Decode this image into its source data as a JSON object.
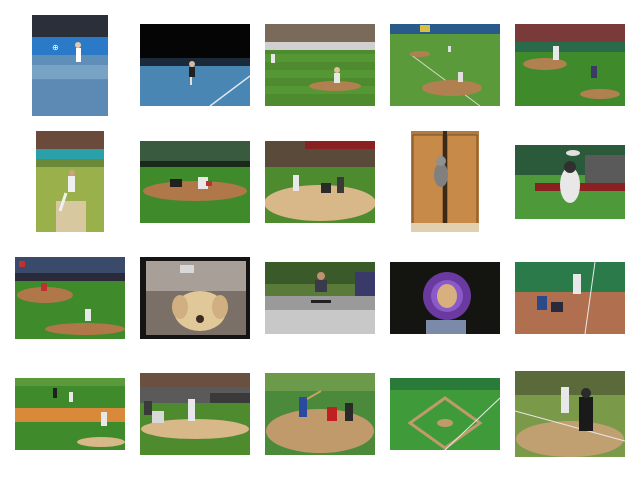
{
  "gallery": {
    "items": [
      {
        "subject": "tennis-player-serving",
        "colors": {
          "bg": "#2a6aa8",
          "ground": "#5f8fb8"
        }
      },
      {
        "subject": "tennis-player-night-court",
        "colors": {
          "bg": "#0b0b0b",
          "ground": "#4a86b4"
        }
      },
      {
        "subject": "baseball-pitcher-infield",
        "colors": {
          "bg": "#6a8a4a",
          "ground": "#4e8a2e"
        }
      },
      {
        "subject": "baseball-pitch-wide-field",
        "colors": {
          "bg": "#3a7a30",
          "ground": "#5a9a3a"
        }
      },
      {
        "subject": "baseball-pitcher-mound",
        "colors": {
          "bg": "#2f6b3a",
          "ground": "#3f8a2a"
        }
      },
      {
        "subject": "cricket-bowler",
        "colors": {
          "bg": "#6e8a3a",
          "ground": "#9ab04a"
        }
      },
      {
        "subject": "baseball-slide-home",
        "colors": {
          "bg": "#3a5a30",
          "ground": "#3f8a2a"
        }
      },
      {
        "subject": "baseball-batter-catcher-umpire",
        "colors": {
          "bg": "#5a4a3a",
          "ground": "#4e8a2e"
        }
      },
      {
        "subject": "cat-in-doorway",
        "colors": {
          "bg": "#a06a30",
          "ground": "#7a5020"
        }
      },
      {
        "subject": "dog-catching-frisbee",
        "colors": {
          "bg": "#2a6a40",
          "ground": "#4e9a3a"
        }
      },
      {
        "subject": "baseball-stadium-pitch",
        "colors": {
          "bg": "#3a4a6a",
          "ground": "#3f8a2a"
        }
      },
      {
        "subject": "dog-at-window",
        "colors": {
          "bg": "#1a1a1a",
          "ground": "#c0a878"
        }
      },
      {
        "subject": "skateboarder-street",
        "colors": {
          "bg": "#3a5a2a",
          "ground": "#9a9a9a"
        }
      },
      {
        "subject": "dog-with-frisbee",
        "colors": {
          "bg": "#1a1a14",
          "ground": "#6a3aa0"
        }
      },
      {
        "subject": "baseball-batter-night",
        "colors": {
          "bg": "#2a5a3a",
          "ground": "#b07050"
        }
      },
      {
        "subject": "baseball-infield-pitch",
        "colors": {
          "bg": "#4a7a2a",
          "ground": "#3f8a2a"
        }
      },
      {
        "subject": "baseball-batter-crowd",
        "colors": {
          "bg": "#5a5a5a",
          "ground": "#4e8a2e"
        }
      },
      {
        "subject": "baseball-swing-home-plate",
        "colors": {
          "bg": "#4a7a3a",
          "ground": "#c09a6a"
        }
      },
      {
        "subject": "baseball-field-aerial",
        "colors": {
          "bg": "#2a7a3a",
          "ground": "#3f9a3a"
        }
      },
      {
        "subject": "baseball-batter-umpire",
        "colors": {
          "bg": "#5a6a3a",
          "ground": "#7a9a4a"
        }
      }
    ]
  }
}
